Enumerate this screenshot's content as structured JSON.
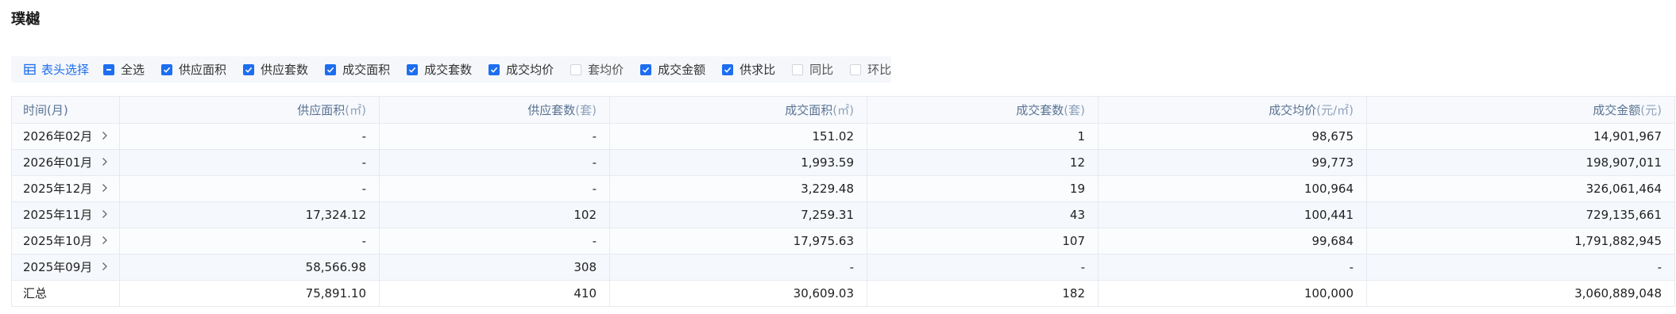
{
  "header": {
    "title": "璞樾"
  },
  "toolbar": {
    "table_pick_label": "表头选择",
    "checkboxes": [
      {
        "label": "全选",
        "state": "indeterminate"
      },
      {
        "label": "供应面积",
        "state": "checked"
      },
      {
        "label": "供应套数",
        "state": "checked"
      },
      {
        "label": "成交面积",
        "state": "checked"
      },
      {
        "label": "成交套数",
        "state": "checked"
      },
      {
        "label": "成交均价",
        "state": "checked"
      },
      {
        "label": "套均价",
        "state": "unchecked"
      },
      {
        "label": "成交金额",
        "state": "checked"
      },
      {
        "label": "供求比",
        "state": "checked"
      },
      {
        "label": "同比",
        "state": "unchecked"
      },
      {
        "label": "环比",
        "state": "unchecked"
      }
    ]
  },
  "table": {
    "columns": [
      {
        "label": "时间(月)",
        "unit": ""
      },
      {
        "label": "供应面积",
        "unit": "(㎡)"
      },
      {
        "label": "供应套数",
        "unit": "(套)"
      },
      {
        "label": "成交面积",
        "unit": "(㎡)"
      },
      {
        "label": "成交套数",
        "unit": "(套)"
      },
      {
        "label": "成交均价",
        "unit": "(元/㎡)"
      },
      {
        "label": "成交金额",
        "unit": "(元)"
      }
    ],
    "rows": [
      [
        "2026年02月",
        "-",
        "-",
        "151.02",
        "1",
        "98,675",
        "14,901,967"
      ],
      [
        "2026年01月",
        "-",
        "-",
        "1,993.59",
        "12",
        "99,773",
        "198,907,011"
      ],
      [
        "2025年12月",
        "-",
        "-",
        "3,229.48",
        "19",
        "100,964",
        "326,061,464"
      ],
      [
        "2025年11月",
        "17,324.12",
        "102",
        "7,259.31",
        "43",
        "100,441",
        "729,135,661"
      ],
      [
        "2025年10月",
        "-",
        "-",
        "17,975.63",
        "107",
        "99,684",
        "1,791,882,945"
      ],
      [
        "2025年09月",
        "58,566.98",
        "308",
        "-",
        "-",
        "-",
        "-"
      ]
    ],
    "total": [
      "汇总",
      "75,891.10",
      "410",
      "30,609.03",
      "182",
      "100,000",
      "3,060,889,048"
    ]
  },
  "colors": {
    "accent": "#1d6ef0",
    "header_text": "#5a7394",
    "border": "#e6eaf0"
  }
}
